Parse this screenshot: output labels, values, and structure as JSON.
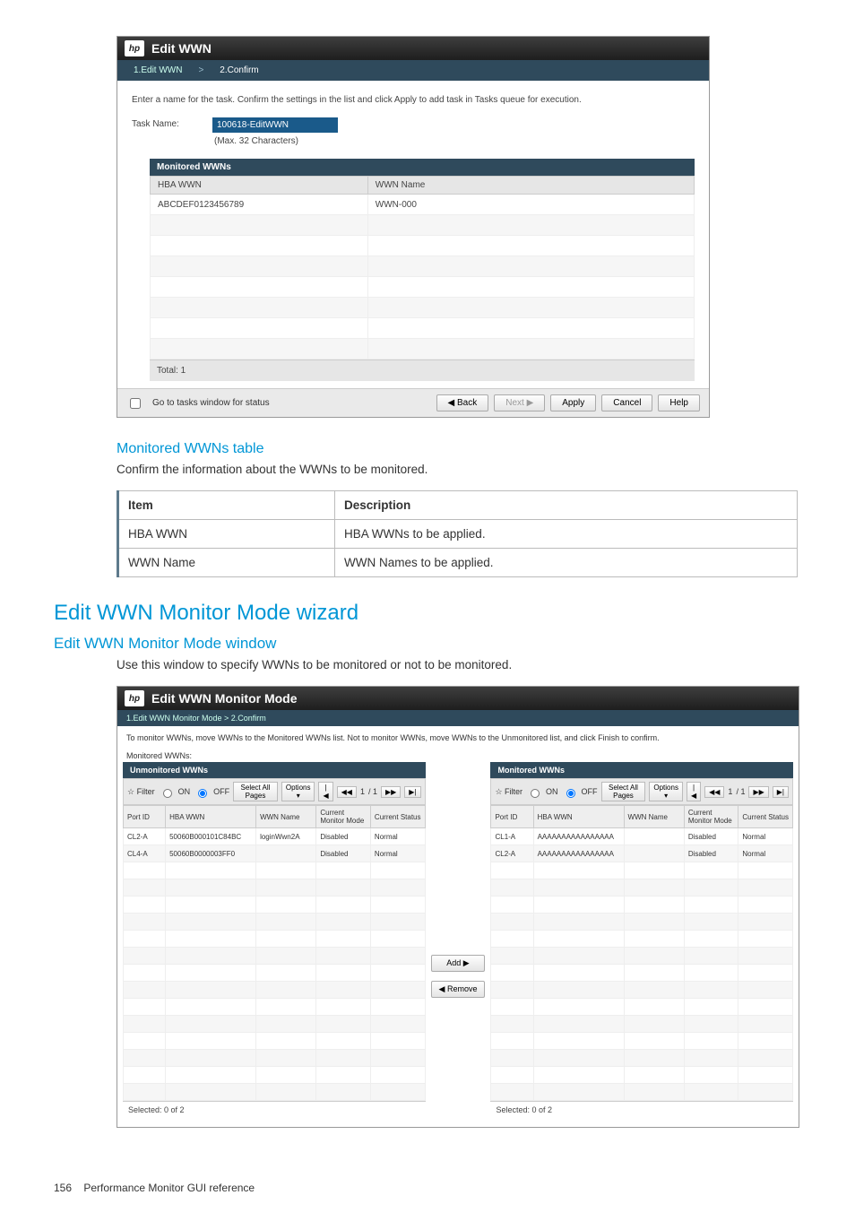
{
  "wizard1": {
    "logo": "hp",
    "title": "Edit WWN",
    "tab1": "1.Edit WWN",
    "tab2": "2.Confirm",
    "instruction": "Enter a name for the task. Confirm the settings in the list and click Apply to add task in Tasks queue for execution.",
    "taskLabel": "Task Name:",
    "taskValue": "100618-EditWWN",
    "taskNote": "(Max. 32 Characters)",
    "tableTitle": "Monitored WWNs",
    "cols": {
      "hba": "HBA WWN",
      "name": "WWN Name"
    },
    "rows": [
      {
        "hba": "ABCDEF0123456789",
        "name": "WWN-000"
      }
    ],
    "total": "Total:  1",
    "footer": {
      "checkboxLabel": "Go to tasks window for status",
      "back": "◀ Back",
      "next": "Next ▶",
      "apply": "Apply",
      "cancel": "Cancel",
      "help": "Help"
    }
  },
  "section1": {
    "title": "Monitored WWNs table",
    "text": "Confirm the information about the WWNs to be monitored."
  },
  "descTable": {
    "h1": "Item",
    "h2": "Description",
    "rows": [
      {
        "item": "HBA WWN",
        "desc": "HBA WWNs to be applied."
      },
      {
        "item": "WWN Name",
        "desc": "WWN Names to be applied."
      }
    ]
  },
  "heading2": "Edit WWN Monitor Mode wizard",
  "subheading2": "Edit WWN Monitor Mode window",
  "text2": "Use this window to specify WWNs to be monitored or not to be monitored.",
  "wizard2": {
    "logo": "hp",
    "title": "Edit WWN Monitor Mode",
    "breadcrumb": "1.Edit WWN Monitor Mode  >  2.Confirm",
    "instruction": "To monitor WWNs, move WWNs to the Monitored WWNs list. Not to monitor WWNs, move WWNs to the Unmonitored list, and click Finish to confirm.",
    "topLabel": "Monitored WWNs:",
    "left": {
      "title": "Unmonitored WWNs",
      "filter": "☆ Filter",
      "on": "ON",
      "off": "OFF",
      "selectAll": "Select All Pages",
      "options": "Options ▾",
      "pageInfo": "/ 1",
      "cols": {
        "port": "Port ID",
        "hba": "HBA WWN",
        "name": "WWN Name",
        "mode": "Current Monitor Mode",
        "status": "Current Status"
      },
      "rows": [
        {
          "port": "CL2-A",
          "hba": "50060B000101C84BC",
          "name": "loginWwn2A",
          "mode": "Disabled",
          "status": "Normal"
        },
        {
          "port": "CL4-A",
          "hba": "50060B0000003FF0",
          "name": "",
          "mode": "Disabled",
          "status": "Normal"
        }
      ],
      "selected": "Selected:  0    of  2"
    },
    "mid": {
      "add": "Add ▶",
      "remove": "◀ Remove"
    },
    "right": {
      "title": "Monitored WWNs",
      "filter": "☆ Filter",
      "on": "ON",
      "off": "OFF",
      "selectAll": "Select All Pages",
      "options": "Options ▾",
      "pageInfo": "/ 1",
      "cols": {
        "port": "Port ID",
        "hba": "HBA WWN",
        "name": "WWN Name",
        "mode": "Current Monitor Mode",
        "status": "Current Status"
      },
      "rows": [
        {
          "port": "CL1-A",
          "hba": "AAAAAAAAAAAAAAAA",
          "name": "",
          "mode": "Disabled",
          "status": "Normal"
        },
        {
          "port": "CL2-A",
          "hba": "AAAAAAAAAAAAAAAA",
          "name": "",
          "mode": "Disabled",
          "status": "Normal"
        }
      ],
      "selected": "Selected:  0    of  2"
    }
  },
  "footer": {
    "page": "156",
    "text": "Performance Monitor GUI reference"
  }
}
